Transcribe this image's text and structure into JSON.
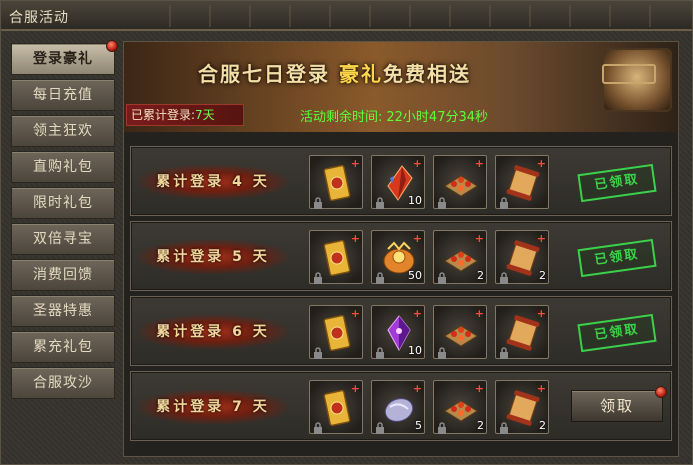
{
  "window": {
    "title": "合服活动"
  },
  "sidebar": {
    "tabs": [
      {
        "label": "登录豪礼",
        "active": true,
        "badge": true
      },
      {
        "label": "每日充值"
      },
      {
        "label": "领主狂欢"
      },
      {
        "label": "直购礼包"
      },
      {
        "label": "限时礼包"
      },
      {
        "label": "双倍寻宝"
      },
      {
        "label": "消费回馈"
      },
      {
        "label": "圣器特惠"
      },
      {
        "label": "累充礼包"
      },
      {
        "label": "合服攻沙"
      }
    ]
  },
  "banner": {
    "title_part1": "合服七日登录",
    "title_part2": "豪礼",
    "title_part3": "免费相送"
  },
  "status": {
    "cumulative_label": "已累计登录:",
    "cumulative_value": "7天",
    "timer_label": "活动剩余时间:",
    "timer_value": "22小时47分34秒"
  },
  "rows": [
    {
      "label": "累计登录 4 天",
      "state": "claimed",
      "state_label": "已领取",
      "items": [
        {
          "icon": "gold-card-icon",
          "qty": ""
        },
        {
          "icon": "red-crystal-icon",
          "qty": "10"
        },
        {
          "icon": "gem-tray-icon",
          "qty": ""
        },
        {
          "icon": "scroll-icon",
          "qty": ""
        }
      ]
    },
    {
      "label": "累计登录 5 天",
      "state": "claimed",
      "state_label": "已领取",
      "items": [
        {
          "icon": "gold-card-icon",
          "qty": ""
        },
        {
          "icon": "orange-orb-icon",
          "qty": "50"
        },
        {
          "icon": "gem-tray-icon",
          "qty": "2"
        },
        {
          "icon": "scroll-icon",
          "qty": "2"
        }
      ]
    },
    {
      "label": "累计登录 6 天",
      "state": "claimed",
      "state_label": "已领取",
      "items": [
        {
          "icon": "gold-card-icon",
          "qty": ""
        },
        {
          "icon": "purple-crystal-icon",
          "qty": "10"
        },
        {
          "icon": "gem-tray-icon",
          "qty": ""
        },
        {
          "icon": "scroll-icon",
          "qty": ""
        }
      ]
    },
    {
      "label": "累计登录 7 天",
      "state": "claimable",
      "state_label": "领取",
      "items": [
        {
          "icon": "gold-card-icon",
          "qty": ""
        },
        {
          "icon": "silver-stone-icon",
          "qty": "5"
        },
        {
          "icon": "gem-tray-icon",
          "qty": "2"
        },
        {
          "icon": "scroll-icon",
          "qty": "2"
        }
      ]
    }
  ],
  "colors": {
    "accent_gold": "#ffd64a",
    "timer_green": "#5cff38",
    "stamp_green": "#3bd14a",
    "badge_red": "#c02010"
  }
}
